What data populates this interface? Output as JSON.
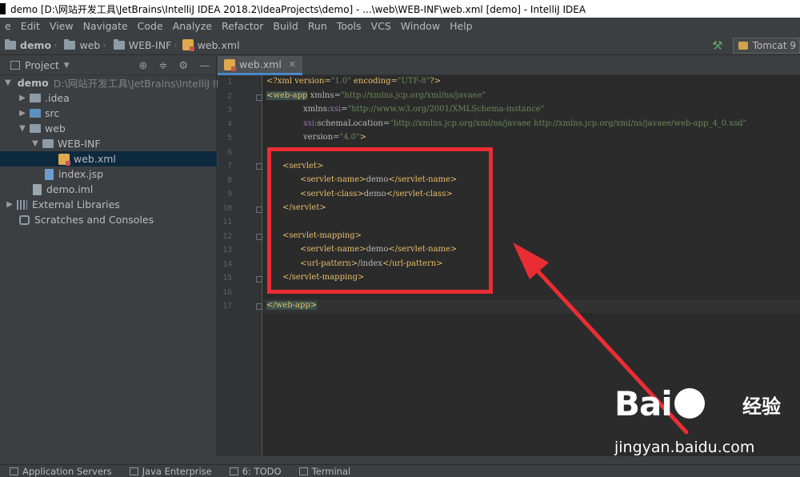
{
  "window": {
    "title": "demo [D:\\网站开发工具\\JetBrains\\IntelliJ IDEA 2018.2\\IdeaProjects\\demo] - ...\\web\\WEB-INF\\web.xml [demo] - IntelliJ IDEA"
  },
  "menu": [
    "e",
    "Edit",
    "View",
    "Navigate",
    "Code",
    "Analyze",
    "Refactor",
    "Build",
    "Run",
    "Tools",
    "VCS",
    "Window",
    "Help"
  ],
  "breadcrumb": [
    "demo",
    "web",
    "WEB-INF",
    "web.xml"
  ],
  "run_config": {
    "label": "Tomcat 9"
  },
  "project_panel": {
    "title": "Project",
    "tree": [
      {
        "label": "demo",
        "extra": "D:\\网站开发工具\\JetBrains\\IntelliJ IDE",
        "arrow": "▼",
        "indent": 0,
        "icon": "folder-icon"
      },
      {
        "label": ".idea",
        "arrow": "▶",
        "indent": 1,
        "icon": "folder-icon"
      },
      {
        "label": "src",
        "arrow": "▶",
        "indent": 1,
        "icon": "folder-icon"
      },
      {
        "label": "web",
        "arrow": "▼",
        "indent": 1,
        "icon": "folder-icon"
      },
      {
        "label": "WEB-INF",
        "arrow": "▼",
        "indent": 2,
        "icon": "folder-icon"
      },
      {
        "label": "web.xml",
        "arrow": "",
        "indent": 4,
        "icon": "xml-icon",
        "selected": true
      },
      {
        "label": "index.jsp",
        "arrow": "",
        "indent": 3,
        "icon": "jsp-icon"
      },
      {
        "label": "demo.iml",
        "arrow": "",
        "indent": 2,
        "icon": "file-icon"
      },
      {
        "label": "External Libraries",
        "arrow": "▶",
        "indent": 0,
        "icon": "library-icon"
      },
      {
        "label": "Scratches and Consoles",
        "arrow": "",
        "indent": 0,
        "icon": "scratch-icon"
      }
    ]
  },
  "editor": {
    "tab": "web.xml",
    "line_numbers": [
      "1",
      "2",
      "3",
      "4",
      "5",
      "6",
      "7",
      "8",
      "9",
      "10",
      "11",
      "12",
      "13",
      "14",
      "15",
      "16",
      "17"
    ],
    "code": {
      "l1": [
        "<?xml version=",
        "\"1.0\"",
        " encoding=",
        "\"UTF-8\"",
        "?>"
      ],
      "l2": [
        "<web-app",
        " xmlns=",
        "\"http://xmlns.jcp.org/xml/ns/javaee\""
      ],
      "l3": [
        "xmlns:",
        "xsi",
        "=",
        "\"http://www.w3.org/2001/XMLSchema-instance\""
      ],
      "l4": [
        "xsi",
        ":schemaLocation=",
        "\"http://xmlns.jcp.org/xml/ns/javaee http://xmlns.jcp.org/xml/ns/javaee/web-app_4_0.xsd\""
      ],
      "l5": [
        "version=",
        "\"4.0\"",
        ">"
      ],
      "l7": "<servlet>",
      "l8": [
        "<servlet-name>",
        "demo",
        "</servlet-name>"
      ],
      "l9": [
        "<servlet-class>",
        "demo",
        "</servlet-class>"
      ],
      "l10": "</servlet>",
      "l12": "<servlet-mapping>",
      "l13": [
        "<servlet-name>",
        "demo",
        "</servlet-name>"
      ],
      "l14": [
        "<url-pattern>",
        "/index",
        "</url-pattern>"
      ],
      "l15": "</servlet-mapping>",
      "l17": "</web-app>"
    }
  },
  "watermark": {
    "logo_left": "Bai",
    "logo_right": "",
    "cn": "经验",
    "url": "jingyan.baidu.com"
  },
  "bottom_tools": [
    "Application Servers",
    "Java Enterprise",
    "6: TODO",
    "Terminal"
  ],
  "colors": {
    "annotation_red": "#ea2d34",
    "tag": "#e8bf6a",
    "value": "#6a8759",
    "selection": "#0d293e"
  }
}
